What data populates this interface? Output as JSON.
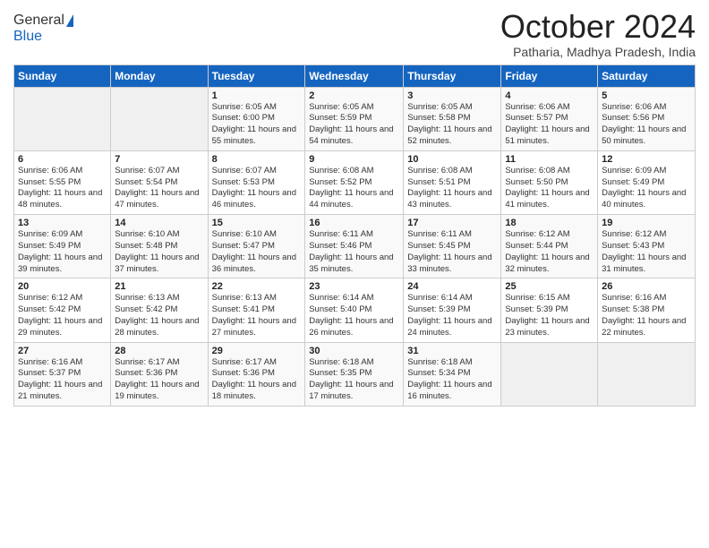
{
  "logo": {
    "line1": "General",
    "line2": "Blue"
  },
  "header": {
    "month": "October 2024",
    "location": "Patharia, Madhya Pradesh, India"
  },
  "weekdays": [
    "Sunday",
    "Monday",
    "Tuesday",
    "Wednesday",
    "Thursday",
    "Friday",
    "Saturday"
  ],
  "weeks": [
    [
      {
        "day": "",
        "info": ""
      },
      {
        "day": "",
        "info": ""
      },
      {
        "day": "1",
        "info": "Sunrise: 6:05 AM\nSunset: 6:00 PM\nDaylight: 11 hours and 55 minutes."
      },
      {
        "day": "2",
        "info": "Sunrise: 6:05 AM\nSunset: 5:59 PM\nDaylight: 11 hours and 54 minutes."
      },
      {
        "day": "3",
        "info": "Sunrise: 6:05 AM\nSunset: 5:58 PM\nDaylight: 11 hours and 52 minutes."
      },
      {
        "day": "4",
        "info": "Sunrise: 6:06 AM\nSunset: 5:57 PM\nDaylight: 11 hours and 51 minutes."
      },
      {
        "day": "5",
        "info": "Sunrise: 6:06 AM\nSunset: 5:56 PM\nDaylight: 11 hours and 50 minutes."
      }
    ],
    [
      {
        "day": "6",
        "info": "Sunrise: 6:06 AM\nSunset: 5:55 PM\nDaylight: 11 hours and 48 minutes."
      },
      {
        "day": "7",
        "info": "Sunrise: 6:07 AM\nSunset: 5:54 PM\nDaylight: 11 hours and 47 minutes."
      },
      {
        "day": "8",
        "info": "Sunrise: 6:07 AM\nSunset: 5:53 PM\nDaylight: 11 hours and 46 minutes."
      },
      {
        "day": "9",
        "info": "Sunrise: 6:08 AM\nSunset: 5:52 PM\nDaylight: 11 hours and 44 minutes."
      },
      {
        "day": "10",
        "info": "Sunrise: 6:08 AM\nSunset: 5:51 PM\nDaylight: 11 hours and 43 minutes."
      },
      {
        "day": "11",
        "info": "Sunrise: 6:08 AM\nSunset: 5:50 PM\nDaylight: 11 hours and 41 minutes."
      },
      {
        "day": "12",
        "info": "Sunrise: 6:09 AM\nSunset: 5:49 PM\nDaylight: 11 hours and 40 minutes."
      }
    ],
    [
      {
        "day": "13",
        "info": "Sunrise: 6:09 AM\nSunset: 5:49 PM\nDaylight: 11 hours and 39 minutes."
      },
      {
        "day": "14",
        "info": "Sunrise: 6:10 AM\nSunset: 5:48 PM\nDaylight: 11 hours and 37 minutes."
      },
      {
        "day": "15",
        "info": "Sunrise: 6:10 AM\nSunset: 5:47 PM\nDaylight: 11 hours and 36 minutes."
      },
      {
        "day": "16",
        "info": "Sunrise: 6:11 AM\nSunset: 5:46 PM\nDaylight: 11 hours and 35 minutes."
      },
      {
        "day": "17",
        "info": "Sunrise: 6:11 AM\nSunset: 5:45 PM\nDaylight: 11 hours and 33 minutes."
      },
      {
        "day": "18",
        "info": "Sunrise: 6:12 AM\nSunset: 5:44 PM\nDaylight: 11 hours and 32 minutes."
      },
      {
        "day": "19",
        "info": "Sunrise: 6:12 AM\nSunset: 5:43 PM\nDaylight: 11 hours and 31 minutes."
      }
    ],
    [
      {
        "day": "20",
        "info": "Sunrise: 6:12 AM\nSunset: 5:42 PM\nDaylight: 11 hours and 29 minutes."
      },
      {
        "day": "21",
        "info": "Sunrise: 6:13 AM\nSunset: 5:42 PM\nDaylight: 11 hours and 28 minutes."
      },
      {
        "day": "22",
        "info": "Sunrise: 6:13 AM\nSunset: 5:41 PM\nDaylight: 11 hours and 27 minutes."
      },
      {
        "day": "23",
        "info": "Sunrise: 6:14 AM\nSunset: 5:40 PM\nDaylight: 11 hours and 26 minutes."
      },
      {
        "day": "24",
        "info": "Sunrise: 6:14 AM\nSunset: 5:39 PM\nDaylight: 11 hours and 24 minutes."
      },
      {
        "day": "25",
        "info": "Sunrise: 6:15 AM\nSunset: 5:39 PM\nDaylight: 11 hours and 23 minutes."
      },
      {
        "day": "26",
        "info": "Sunrise: 6:16 AM\nSunset: 5:38 PM\nDaylight: 11 hours and 22 minutes."
      }
    ],
    [
      {
        "day": "27",
        "info": "Sunrise: 6:16 AM\nSunset: 5:37 PM\nDaylight: 11 hours and 21 minutes."
      },
      {
        "day": "28",
        "info": "Sunrise: 6:17 AM\nSunset: 5:36 PM\nDaylight: 11 hours and 19 minutes."
      },
      {
        "day": "29",
        "info": "Sunrise: 6:17 AM\nSunset: 5:36 PM\nDaylight: 11 hours and 18 minutes."
      },
      {
        "day": "30",
        "info": "Sunrise: 6:18 AM\nSunset: 5:35 PM\nDaylight: 11 hours and 17 minutes."
      },
      {
        "day": "31",
        "info": "Sunrise: 6:18 AM\nSunset: 5:34 PM\nDaylight: 11 hours and 16 minutes."
      },
      {
        "day": "",
        "info": ""
      },
      {
        "day": "",
        "info": ""
      }
    ]
  ]
}
